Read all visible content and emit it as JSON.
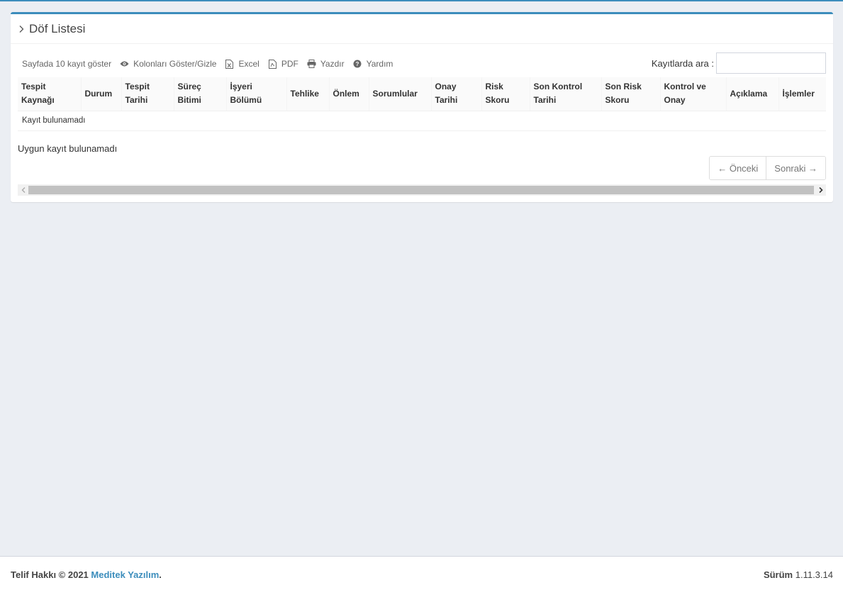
{
  "panel": {
    "title": "Döf Listesi"
  },
  "toolbar": {
    "page_size": "Sayfada 10 kayıt göster",
    "columns": "Kolonları Göster/Gizle",
    "excel": "Excel",
    "pdf": "PDF",
    "print": "Yazdır",
    "help": "Yardım",
    "search_label": "Kayıtlarda ara :",
    "search_value": ""
  },
  "table": {
    "headers": [
      [
        "Tespit",
        "Kaynağı"
      ],
      [
        "Durum",
        ""
      ],
      [
        "Tespit",
        "Tarihi"
      ],
      [
        "Süreç",
        "Bitimi"
      ],
      [
        "İşyeri",
        "Bölümü"
      ],
      [
        "Tehlike",
        ""
      ],
      [
        "Önlem",
        ""
      ],
      [
        "Sorumlular",
        ""
      ],
      [
        "Onay",
        "Tarihi"
      ],
      [
        "Risk",
        "Skoru"
      ],
      [
        "Son Kontrol",
        "Tarihi"
      ],
      [
        "Son Risk",
        "Skoru"
      ],
      [
        "Kontrol ve",
        "Onay"
      ],
      [
        "Açıklama",
        ""
      ],
      [
        "İşlemler",
        ""
      ]
    ],
    "empty_message": "Kayıt bulunamadı"
  },
  "info": "Uygun kayıt bulunamadı",
  "pager": {
    "prev": "← Önceki",
    "next": "Sonraki →"
  },
  "footer": {
    "copyright_prefix": "Telif Hakkı © 2021",
    "company": "Meditek Yazılım",
    "suffix": ".",
    "version_label": "Sürüm",
    "version": "1.11.3.14"
  },
  "colors": {
    "accent": "#3c8dbc",
    "background": "#ebeef3"
  },
  "icons": [
    "chevron-right-icon",
    "eye-icon",
    "file-excel-icon",
    "file-pdf-icon",
    "print-icon",
    "question-circle-icon"
  ]
}
